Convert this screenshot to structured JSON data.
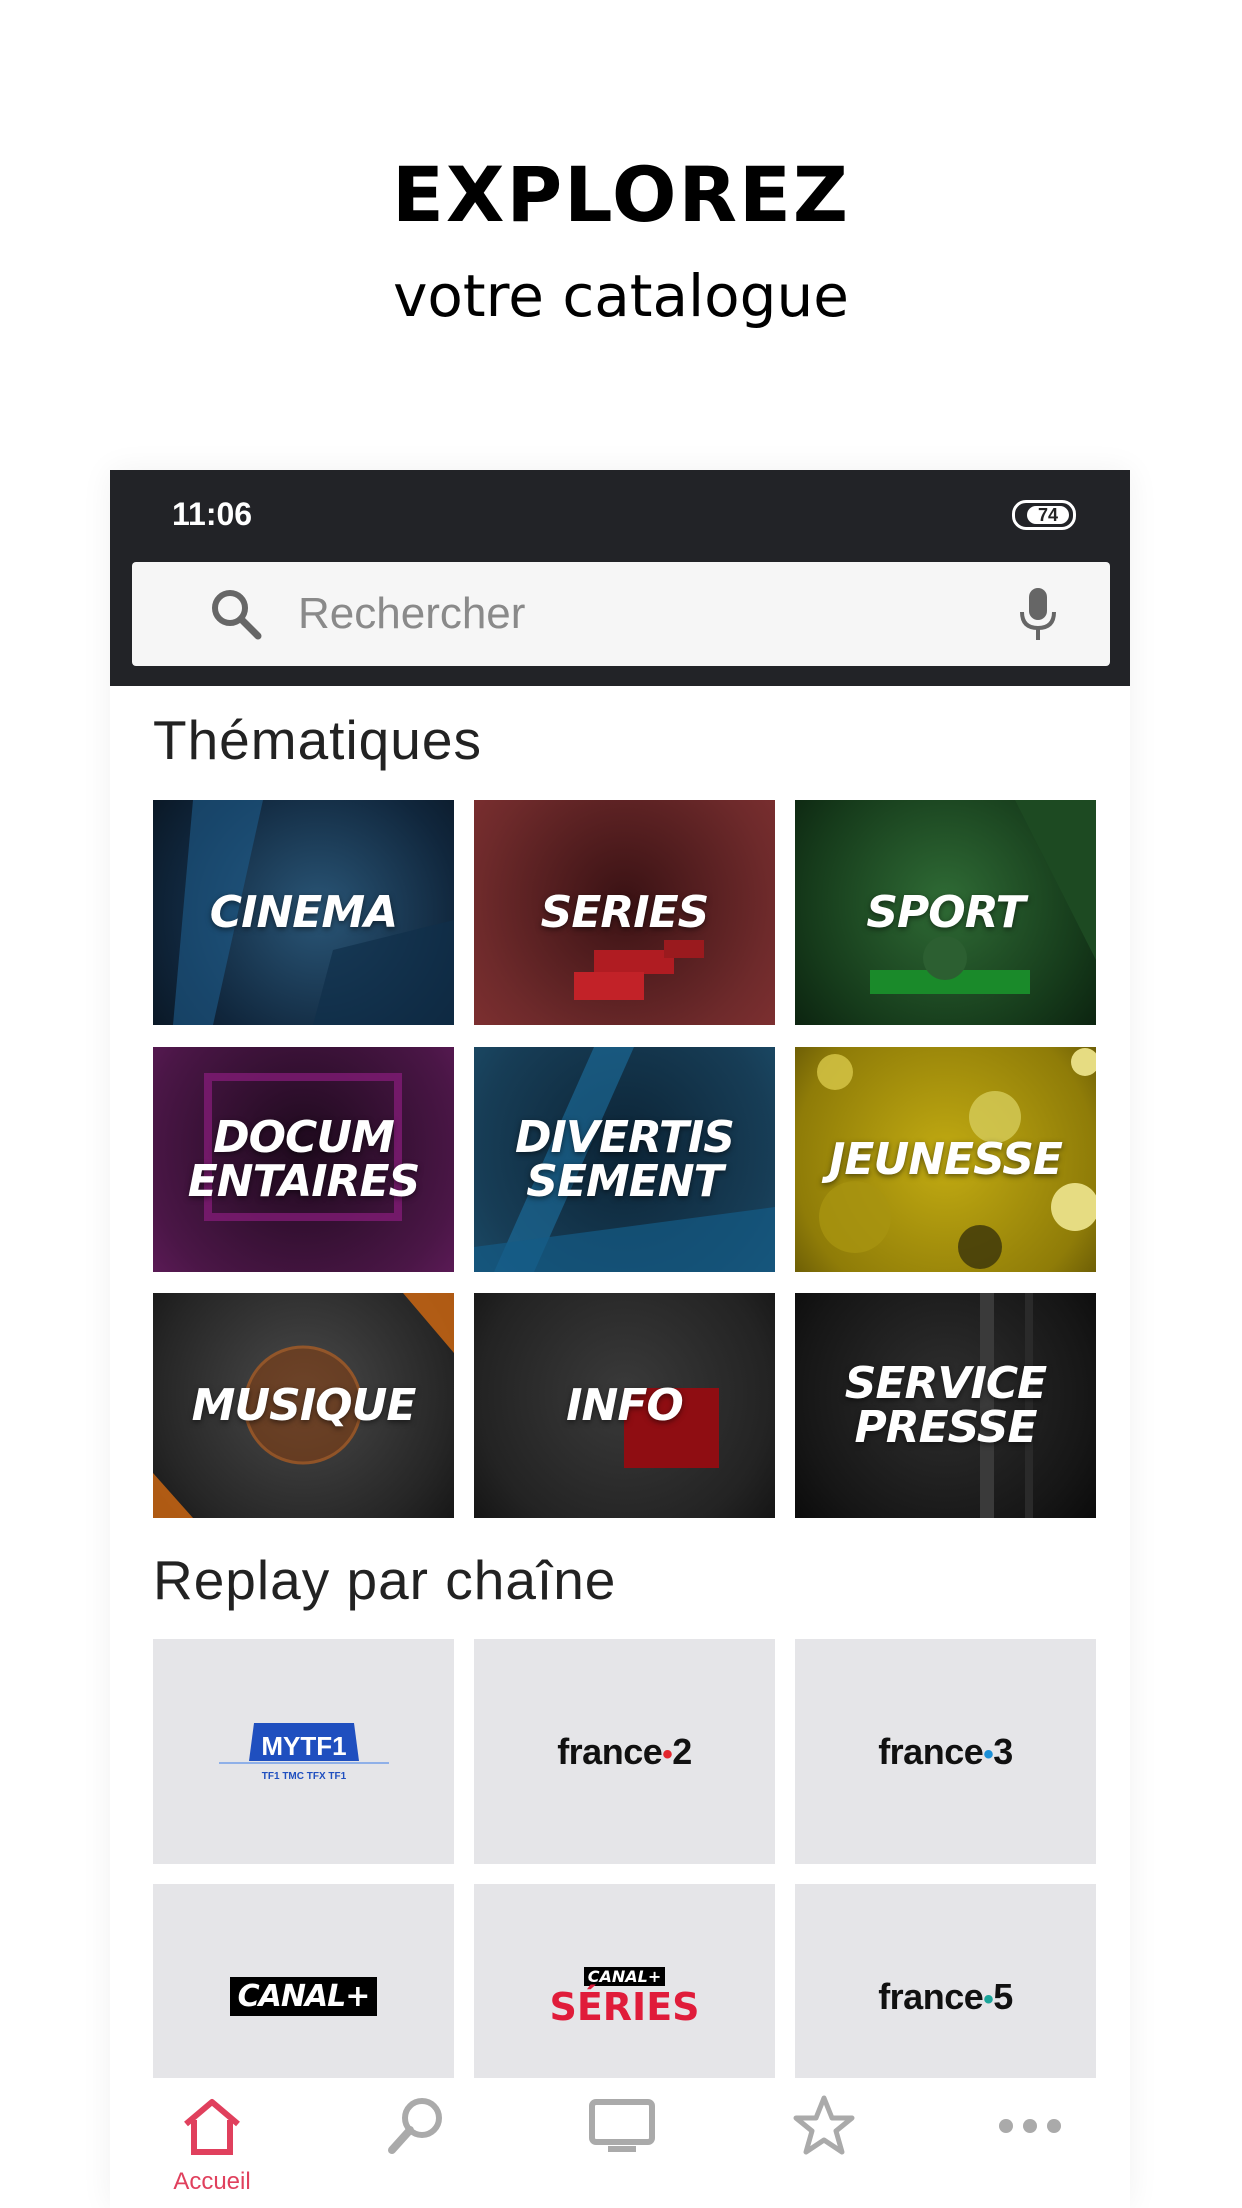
{
  "headline": "EXPLOREZ",
  "subline": "votre catalogue",
  "status": {
    "time": "11:06",
    "battery": "74"
  },
  "search": {
    "placeholder": "Rechercher"
  },
  "sections": {
    "themes_title": "Thématiques",
    "replay_title": "Replay par chaîne"
  },
  "themes": [
    {
      "label": "CINEMA",
      "color": "#1c3a57"
    },
    {
      "label": "SERIES",
      "color": "#5a1a1d"
    },
    {
      "label": "SPORT",
      "color": "#1b4422"
    },
    {
      "label": "DOCUM\nENTAIRES",
      "color": "#3a1038"
    },
    {
      "label": "DIVERTIS\nSEMENT",
      "color": "#143a52"
    },
    {
      "label": "JEUNESSE",
      "color": "#b8a011"
    },
    {
      "label": "MUSIQUE",
      "color": "#2b2b2b"
    },
    {
      "label": "INFO",
      "color": "#262626"
    },
    {
      "label": "SERVICE\nPRESSE",
      "color": "#111111"
    }
  ],
  "channels": [
    {
      "name": "MYTF1",
      "sub": "TF1 TMC TFX TF1"
    },
    {
      "name_a": "france",
      "name_b": "2",
      "dot_color": "#e3262e"
    },
    {
      "name_a": "france",
      "name_b": "3",
      "dot_color": "#1b8fd6"
    },
    {
      "name": "CANAL+"
    },
    {
      "name_top": "CANAL+",
      "name_bottom": "SÉRIES",
      "color": "#e01c3a"
    },
    {
      "name_a": "france",
      "name_b": "5",
      "dot_color": "#1aa59a"
    }
  ],
  "nav": {
    "home_label": "Accueil",
    "accent": "#e0405d"
  }
}
